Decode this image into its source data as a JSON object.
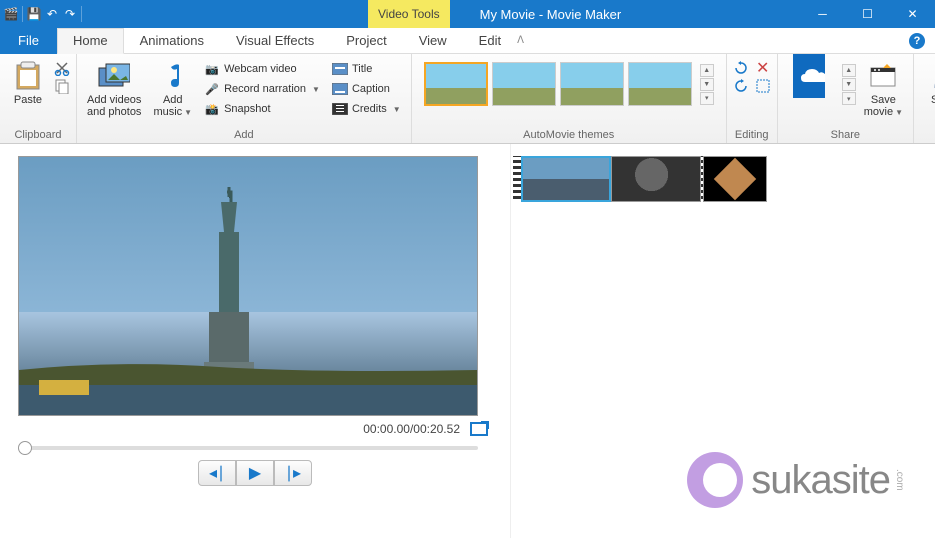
{
  "titlebar": {
    "video_tools": "Video Tools",
    "window_title": "My Movie - Movie Maker"
  },
  "menu": {
    "file": "File",
    "tabs": [
      "Home",
      "Animations",
      "Visual Effects",
      "Project",
      "View"
    ],
    "edit": "Edit"
  },
  "ribbon": {
    "clipboard": {
      "label": "Clipboard",
      "paste": "Paste"
    },
    "add": {
      "label": "Add",
      "add_videos": "Add videos\nand photos",
      "add_music": "Add\nmusic",
      "webcam": "Webcam video",
      "record": "Record narration",
      "snapshot": "Snapshot",
      "title": "Title",
      "caption": "Caption",
      "credits": "Credits"
    },
    "themes": {
      "label": "AutoMovie themes"
    },
    "editing": {
      "label": "Editing"
    },
    "share": {
      "label": "Share",
      "save_movie": "Save\nmovie"
    },
    "signin": {
      "label": "Sign\nin"
    }
  },
  "preview": {
    "time": "00:00.00/00:20.52"
  },
  "watermark": {
    "text": "sukasite",
    "com": ".com"
  }
}
